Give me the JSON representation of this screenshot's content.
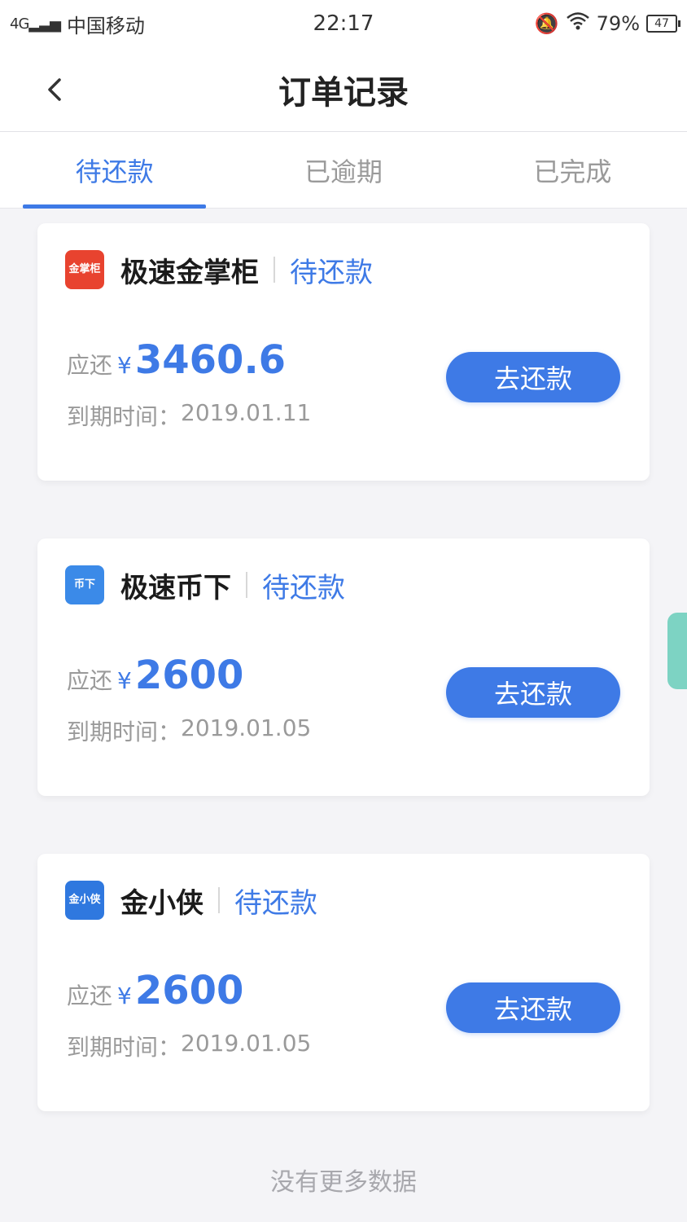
{
  "status_bar": {
    "signal": "4G",
    "carrier": "中国移动",
    "time": "22:17",
    "battery_percent": "79%",
    "battery_glyph": "47"
  },
  "nav": {
    "title": "订单记录"
  },
  "tabs": [
    {
      "label": "待还款",
      "active": true
    },
    {
      "label": "已逾期",
      "active": false
    },
    {
      "label": "已完成",
      "active": false
    }
  ],
  "orders": [
    {
      "app_name": "极速金掌柜",
      "icon_text": "金掌柜",
      "icon_color": "#e8432f",
      "status": "待还款",
      "amount_label": "应还",
      "currency": "¥",
      "amount": "3460.6",
      "due_label": "到期时间：",
      "due_date": "2019.01.11",
      "button": "去还款"
    },
    {
      "app_name": "极速币下",
      "icon_text": "币下",
      "icon_color": "#3b8ae8",
      "status": "待还款",
      "amount_label": "应还",
      "currency": "¥",
      "amount": "2600",
      "due_label": "到期时间：",
      "due_date": "2019.01.05",
      "button": "去还款"
    },
    {
      "app_name": "金小侠",
      "icon_text": "金小侠",
      "icon_color": "#2f78df",
      "status": "待还款",
      "amount_label": "应还",
      "currency": "¥",
      "amount": "2600",
      "due_label": "到期时间：",
      "due_date": "2019.01.05",
      "button": "去还款"
    }
  ],
  "footer": {
    "no_more": "没有更多数据"
  },
  "colors": {
    "accent": "#3e7ae6",
    "muted_text": "#9a9a9a",
    "side_tab": "#7dd3c3"
  }
}
